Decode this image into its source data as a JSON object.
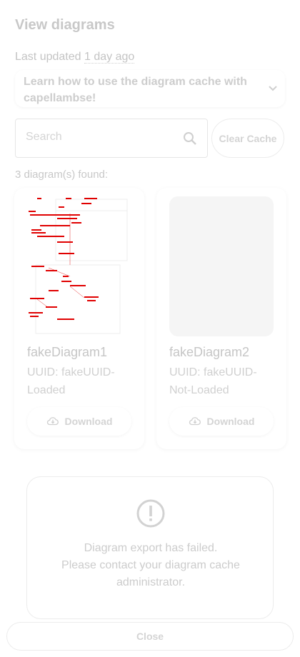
{
  "dialog": {
    "title": "View diagrams",
    "last_updated_prefix": "Last updated",
    "last_updated_value": "1 day ago"
  },
  "info_expander": {
    "label": "Learn how to use the diagram cache with capellambse!",
    "icon": "chevron-down-icon"
  },
  "search": {
    "placeholder": "Search",
    "value": "",
    "icon": "search-icon"
  },
  "clear_button": {
    "label": "Clear Cache"
  },
  "results_count": "3 diagram(s) found:",
  "diagrams": [
    {
      "name": "fakeDiagram1",
      "uuid": "UUID: fakeUUID-Loaded",
      "download_label": "Download",
      "has_preview": true
    },
    {
      "name": "fakeDiagram2",
      "uuid": "UUID: fakeUUID-Not-Loaded",
      "download_label": "Download",
      "has_preview": false
    }
  ],
  "error": {
    "icon": "error-icon",
    "message_line1": "Diagram export has failed.",
    "message_line2": "Please contact your diagram cache administrator."
  },
  "close_button": {
    "label": "Close"
  },
  "colors": {
    "diagram_ink": "#e00000",
    "faded_text": "#c8c8c8"
  }
}
